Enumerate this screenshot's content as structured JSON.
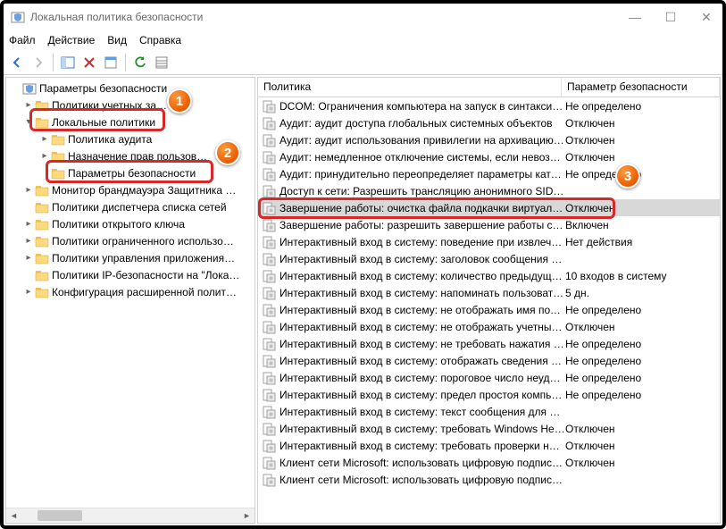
{
  "window": {
    "title": "Локальная политика безопасности",
    "btn_min": "—",
    "btn_max": "☐",
    "btn_close": "✕"
  },
  "menu": {
    "file": "Файл",
    "action": "Действие",
    "view": "Вид",
    "help": "Справка"
  },
  "tree": {
    "root": "Параметры безопасности",
    "items": [
      {
        "label": "Политики учетных за…",
        "depth": 1,
        "exp": ">"
      },
      {
        "label": "Локальные политики",
        "depth": 1,
        "exp": "v",
        "callout": 1
      },
      {
        "label": "Политика аудита",
        "depth": 2,
        "exp": ">"
      },
      {
        "label": "Назначение прав пользов…",
        "depth": 2,
        "exp": ">",
        "covered": true
      },
      {
        "label": "Параметры безопасности",
        "depth": 2,
        "exp": "",
        "callout": 2
      },
      {
        "label": "Монитор брандмауэра Защитника …",
        "depth": 1,
        "exp": ">"
      },
      {
        "label": "Политики диспетчера списка сетей",
        "depth": 1,
        "exp": ""
      },
      {
        "label": "Политики открытого ключа",
        "depth": 1,
        "exp": ">"
      },
      {
        "label": "Политики ограниченного использо…",
        "depth": 1,
        "exp": ">"
      },
      {
        "label": "Политики управления приложения…",
        "depth": 1,
        "exp": ">"
      },
      {
        "label": "Политики IP-безопасности на \"Лока…",
        "depth": 1,
        "exp": ""
      },
      {
        "label": "Конфигурация расширенной полит…",
        "depth": 1,
        "exp": ">"
      }
    ]
  },
  "list": {
    "col_policy": "Политика",
    "col_setting": "Параметр безопасности",
    "rows": [
      {
        "policy": "DCOM: Ограничения компьютера на запуск в синтаксисе…",
        "setting": "Не определено"
      },
      {
        "policy": "Аудит: аудит доступа глобальных системных объектов",
        "setting": "Отключен"
      },
      {
        "policy": "Аудит: аудит использования привилегии на архивацию и…",
        "setting": "Отключен"
      },
      {
        "policy": "Аудит: немедленное отключение системы, если невозмо…",
        "setting": "Отключен"
      },
      {
        "policy": "Аудит: принудительно переопределяет параметры катег…",
        "setting": "Не определено",
        "badge": 3
      },
      {
        "policy": "Доступ к сети: Разрешить трансляцию анонимного SID …",
        "setting": ""
      },
      {
        "policy": "Завершение работы: очистка файла подкачки виртуальн…",
        "setting": "Отключен",
        "sel": true,
        "callout": 3
      },
      {
        "policy": "Завершение работы: разрешить завершение работы сис…",
        "setting": "Включен"
      },
      {
        "policy": "Интерактивный вход в систему:  поведение при извлечен…",
        "setting": "Нет действия"
      },
      {
        "policy": "Интерактивный вход в систему: заголовок сообщения дл…",
        "setting": ""
      },
      {
        "policy": "Интерактивный вход в систему: количество предыдущих…",
        "setting": "10 входов в систему"
      },
      {
        "policy": "Интерактивный вход в систему: напоминать пользователя…",
        "setting": "5 дн."
      },
      {
        "policy": "Интерактивный вход в систему: не отображать имя поль…",
        "setting": "Не определено"
      },
      {
        "policy": "Интерактивный вход в систему: не отображать учетные д…",
        "setting": "Отключен"
      },
      {
        "policy": "Интерактивный вход в систему: не требовать нажатия CT…",
        "setting": "Не определено"
      },
      {
        "policy": "Интерактивный вход в систему: отображать сведения о п…",
        "setting": "Не определено"
      },
      {
        "policy": "Интерактивный вход в систему: пороговое число неудач…",
        "setting": "Не определено"
      },
      {
        "policy": "Интерактивный вход в систему: предел простоя компью…",
        "setting": "Не определено"
      },
      {
        "policy": "Интерактивный вход в систему: текст сообщения для пол…",
        "setting": ""
      },
      {
        "policy": "Интерактивный вход в систему: требовать Windows Hello…",
        "setting": "Отключен"
      },
      {
        "policy": "Интерактивный вход в систему: требовать проверки на к…",
        "setting": "Отключен"
      },
      {
        "policy": "Клиент сети Microsoft: использовать цифровую подпись (…",
        "setting": "Отключен"
      },
      {
        "policy": "Клиент сети Microsoft: использовать цифровую подпись …",
        "setting": ""
      }
    ]
  },
  "badges": {
    "1": "1",
    "2": "2",
    "3": "3"
  }
}
